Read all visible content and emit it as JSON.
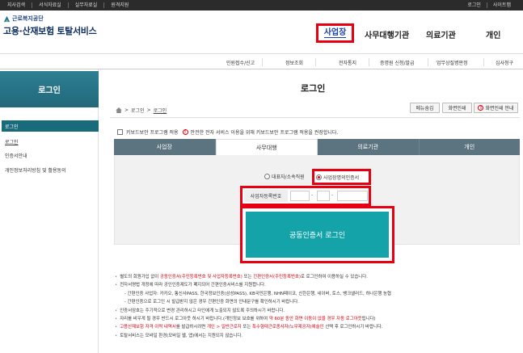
{
  "topbar": {
    "left": [
      "지사검색",
      "서식자료실",
      "실무자료실",
      "원격지원"
    ],
    "right": [
      "로그인",
      "사이트맵"
    ]
  },
  "logo": {
    "org": "근로복지공단",
    "service": "고용·산재보험 토탈서비스"
  },
  "mainnav": {
    "business": "사업장",
    "agency": "사무대행기관",
    "medical": "의료기관",
    "personal": "개인"
  },
  "subnav": [
    "민원접수/신고",
    "정보조회",
    "전자통지",
    "증명원 신청/발급",
    "업무상질병판정",
    "심사청구"
  ],
  "sidebar": {
    "title": "로그인",
    "active": "로그인",
    "items": [
      "로그인",
      "인증서안내",
      "개인정보처리방침 및 활용동의"
    ]
  },
  "page": {
    "title": "로그인",
    "breadcrumb_home": "로그인",
    "breadcrumb_current": "로그인",
    "buttons": {
      "menu_hide": "메뉴숨김",
      "print": "화면인쇄",
      "guide": "화면인쇄 안내"
    },
    "keyboard_label": "키보드보안 프로그램 적용",
    "keyboard_warning": "안전한 전자 서비스 이용을 위해 키보드보안 프로그램 적용을 권장합니다."
  },
  "tabs": [
    "사업장",
    "사무대행",
    "의료기관",
    "개인"
  ],
  "login": {
    "radio_rep": "대표자/소속직원",
    "radio_cert": "사업장명의인증서",
    "reg_label": "사업자등록번호",
    "reg_sep": "-",
    "cert_button": "공동인증서 로그인"
  },
  "notice": {
    "l1a": "별도의 회원가입 없이 ",
    "l1b": "공동인증서(주민등록번호 및 사업자등록번호)",
    "l1c": " 또는 ",
    "l1d": "간편인증서(주민등록번호)",
    "l1e": "로 로그인하여 이용하실 수 있습니다.",
    "l2": "전자서명법 개정에 따라 공인인증제도가 폐지되어 간편인증서비스를 지원합니다.",
    "l3": "- 간편인증 사업자: 카카오, 통신사PASS, 한국정보인증(삼성PASS), KB국민은행, NHN페이코, 신한은행, 네이버, 토스, 뱅크샐러드, 하나은행 농협",
    "l4": "- 간편인증으로 로그인 시 발급받지 않은 경우 간편인증 화면의 안내문구를 확인하시기 바랍니다.",
    "l5": "인증서암호는 주기적으로 변경 관리하시고 타인에게 노출되지 않도록 주의하시기 바랍니다.",
    "l6a": "자리를 비우게 될 경우 반드시 로그아웃 하시기 바랍니다.(개인정보 보호를 위하여 ",
    "l6b": "약 60분 동안 화면 이동이 없을 경우 자동 로그아웃",
    "l6c": "됩니다)",
    "l7a": "고용산재보험 자격 이력 내역서",
    "l7b": "를 발급하시려면 ",
    "l7c": "개인 > 일반근로자",
    "l7d": " 또는 ",
    "l7e": "특수형태근로종사자(노무제공자)예술인",
    "l7f": " 선택 후 로그인하시기 바랍니다.",
    "l8": "토탈서비스는 모바일 환경(모바일 웹, 앱)에서는 지원되지 않습니다."
  },
  "colors": {
    "teal": "#14a3a8",
    "highlight": "#e60012",
    "tab_bg": "#5c7380"
  }
}
